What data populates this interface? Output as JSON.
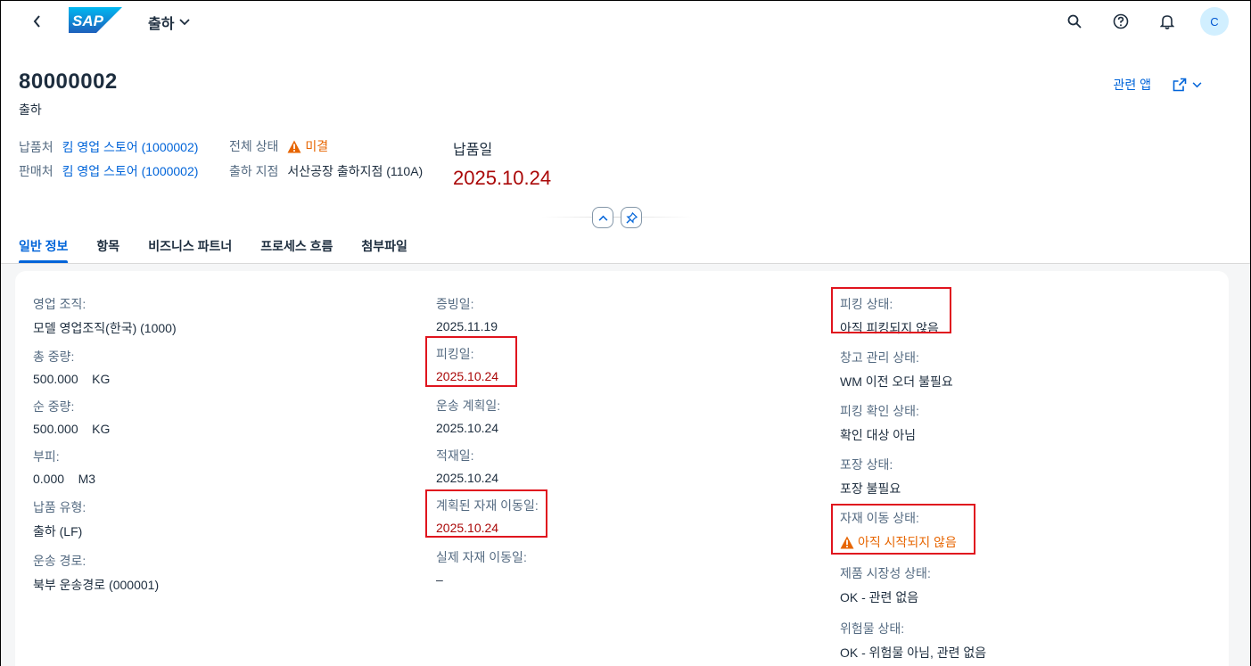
{
  "shell": {
    "app_title": "출하",
    "avatar_initial": "C"
  },
  "header": {
    "object_id": "80000002",
    "object_type": "출하",
    "related_apps": "관련 앱",
    "ship_to_label": "납품처",
    "ship_to_value": "킴 영업 스토어 (1000002)",
    "sold_to_label": "판매처",
    "sold_to_value": "킴 영업 스토어 (1000002)",
    "overall_status_label": "전체 상태",
    "overall_status_value": "미결",
    "shipping_point_label": "출하 지점",
    "shipping_point_value": "서산공장 출하지점 (110A)",
    "delivery_date_label": "납품일",
    "delivery_date_value": "2025.10.24"
  },
  "tabs": [
    {
      "label": "일반 정보"
    },
    {
      "label": "항목"
    },
    {
      "label": "비즈니스 파트너"
    },
    {
      "label": "프로세스 흐름"
    },
    {
      "label": "첨부파일"
    }
  ],
  "general": {
    "col1": [
      {
        "label": "영업 조직:",
        "value": "모델 영업조직(한국) (1000)"
      },
      {
        "label": "총 중량:",
        "value": "500.000    KG"
      },
      {
        "label": "순 중량:",
        "value": "500.000    KG"
      },
      {
        "label": "부피:",
        "value": "0.000    M3"
      },
      {
        "label": "납품 유형:",
        "value": "출하 (LF)"
      },
      {
        "label": "운송 경로:",
        "value": "북부 운송경로 (000001)"
      }
    ],
    "col2": [
      {
        "label": "증빙일:",
        "value": "2025.11.19"
      },
      {
        "label": "피킹일:",
        "value": "2025.10.24"
      },
      {
        "label": "운송 계획일:",
        "value": "2025.10.24"
      },
      {
        "label": "적재일:",
        "value": "2025.10.24"
      },
      {
        "label": "계획된 자재 이동일:",
        "value": "2025.10.24"
      },
      {
        "label": "실제 자재 이동일:",
        "value": "–"
      }
    ],
    "col3": [
      {
        "label": "피킹 상태:",
        "value": "아직 피킹되지 않음"
      },
      {
        "label": "창고 관리 상태:",
        "value": "WM 이전 오더 불필요"
      },
      {
        "label": "피킹 확인 상태:",
        "value": "확인 대상 아님"
      },
      {
        "label": "포장 상태:",
        "value": "포장 불필요"
      },
      {
        "label": "자재 이동 상태:",
        "value": "아직 시작되지 않음"
      },
      {
        "label": "제품 시장성 상태:",
        "value": "OK - 관련 없음"
      },
      {
        "label": "위험물 상태:",
        "value": "OK - 위험물 아님, 관련 없음"
      }
    ]
  }
}
